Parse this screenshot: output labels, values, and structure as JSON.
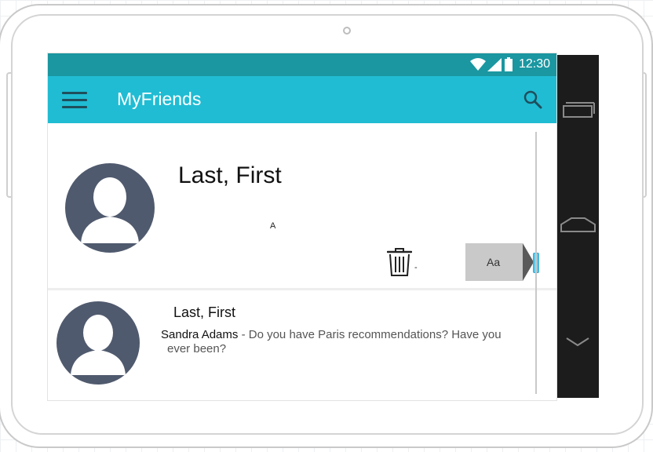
{
  "status_bar": {
    "time": "12:30",
    "icons": [
      "wifi-icon",
      "signal-icon",
      "battery-icon"
    ]
  },
  "app_bar": {
    "title": "MyFriends",
    "menu_icon": "hamburger-menu-icon",
    "search_icon": "search-icon"
  },
  "card_expanded": {
    "name": "Last, First",
    "stray_char": "A",
    "stray_dash": "-",
    "trash_icon": "trash-icon",
    "format_button_label": "Aa"
  },
  "card_message": {
    "name": "Last, First",
    "sender": "Sandra Adams",
    "separator": " - ",
    "preview_line1": "Do you have Paris recommendations? Have you",
    "preview_line2": "ever been?"
  },
  "nav_bar": {
    "buttons": [
      "recent-apps-icon",
      "home-icon",
      "back-chevron-icon"
    ]
  },
  "colors": {
    "status_bar": "#1a97a1",
    "app_bar": "#20bcd3",
    "avatar": "#505a6e",
    "nav_bar": "#1c1c1c",
    "scroll_handle": "#5bc8e8"
  }
}
